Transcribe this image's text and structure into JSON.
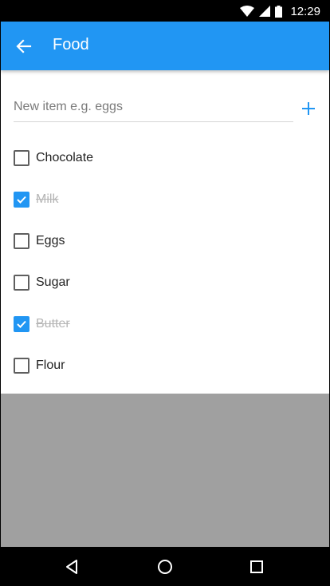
{
  "status_bar": {
    "time": "12:29",
    "icons": [
      "wifi-icon",
      "signal-icon",
      "battery-icon"
    ]
  },
  "app_bar": {
    "title": "Food",
    "back_icon": "arrow-back-icon",
    "color": "#2196f3"
  },
  "new_item": {
    "placeholder": "New item e.g. eggs",
    "value": "",
    "add_icon": "plus-icon"
  },
  "items": [
    {
      "label": "Chocolate",
      "checked": false
    },
    {
      "label": "Milk",
      "checked": true
    },
    {
      "label": "Eggs",
      "checked": false
    },
    {
      "label": "Sugar",
      "checked": false
    },
    {
      "label": "Butter",
      "checked": true
    },
    {
      "label": "Flour",
      "checked": false
    }
  ],
  "nav_bar": {
    "icons": [
      "back-triangle-icon",
      "home-circle-icon",
      "recents-square-icon"
    ]
  }
}
